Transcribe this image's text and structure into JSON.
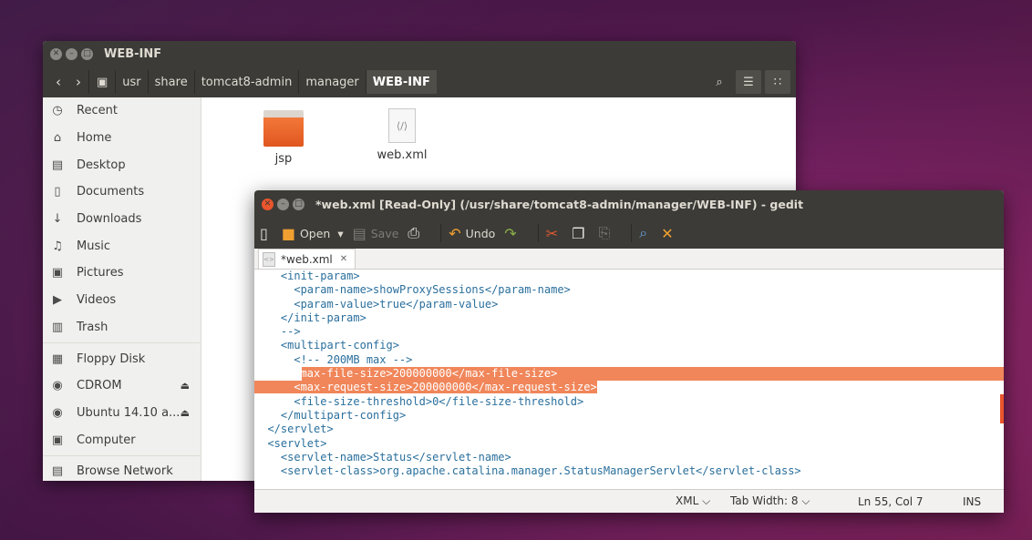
{
  "files": {
    "title": "WEB-INF",
    "breadcrumbs": [
      "usr",
      "share",
      "tomcat8-admin",
      "manager",
      "WEB-INF"
    ],
    "sidebar": [
      {
        "label": "Recent",
        "icon": "clock-icon"
      },
      {
        "label": "Home",
        "icon": "home-icon"
      },
      {
        "label": "Desktop",
        "icon": "desktop-icon"
      },
      {
        "label": "Documents",
        "icon": "documents-icon"
      },
      {
        "label": "Downloads",
        "icon": "downloads-icon"
      },
      {
        "label": "Music",
        "icon": "music-icon"
      },
      {
        "label": "Pictures",
        "icon": "pictures-icon"
      },
      {
        "label": "Videos",
        "icon": "videos-icon"
      },
      {
        "label": "Trash",
        "icon": "trash-icon"
      },
      {
        "label": "Floppy Disk",
        "icon": "floppy-icon"
      },
      {
        "label": "CDROM",
        "icon": "disc-icon"
      },
      {
        "label": "Ubuntu 14.10 a...",
        "icon": "disc-icon"
      },
      {
        "label": "Computer",
        "icon": "computer-icon"
      },
      {
        "label": "Browse Network",
        "icon": "network-icon"
      }
    ],
    "items": [
      {
        "name": "jsp",
        "type": "folder"
      },
      {
        "name": "web.xml",
        "type": "xml"
      }
    ]
  },
  "gedit": {
    "title": "*web.xml [Read-Only] (/usr/share/tomcat8-admin/manager/WEB-INF) - gedit",
    "toolbar": {
      "open": "Open",
      "save": "Save",
      "undo": "Undo"
    },
    "tab_label": "*web.xml",
    "code_lines": [
      "    <init-param>",
      "      <param-name>showProxySessions</param-name>",
      "      <param-value>true</param-value>",
      "    </init-param>",
      "    -->",
      "    <multipart-config>",
      "      <!-- 200MB max -->",
      "      <max-file-size>200000000</max-file-size>",
      "      <max-request-size>200000000</max-request-size>",
      "      <file-size-threshold>0</file-size-threshold>",
      "    </multipart-config>",
      "  </servlet>",
      "  <servlet>",
      "    <servlet-name>Status</servlet-name>",
      "    <servlet-class>org.apache.catalina.manager.StatusManagerServlet</servlet-class>"
    ],
    "status": {
      "language": "XML",
      "tab_width": "Tab Width: 8",
      "position": "Ln 55, Col 7",
      "mode": "INS"
    }
  },
  "colors": {
    "accent": "#e9552c",
    "selection": "#f0865a",
    "code_tag": "#2a6f9c"
  }
}
